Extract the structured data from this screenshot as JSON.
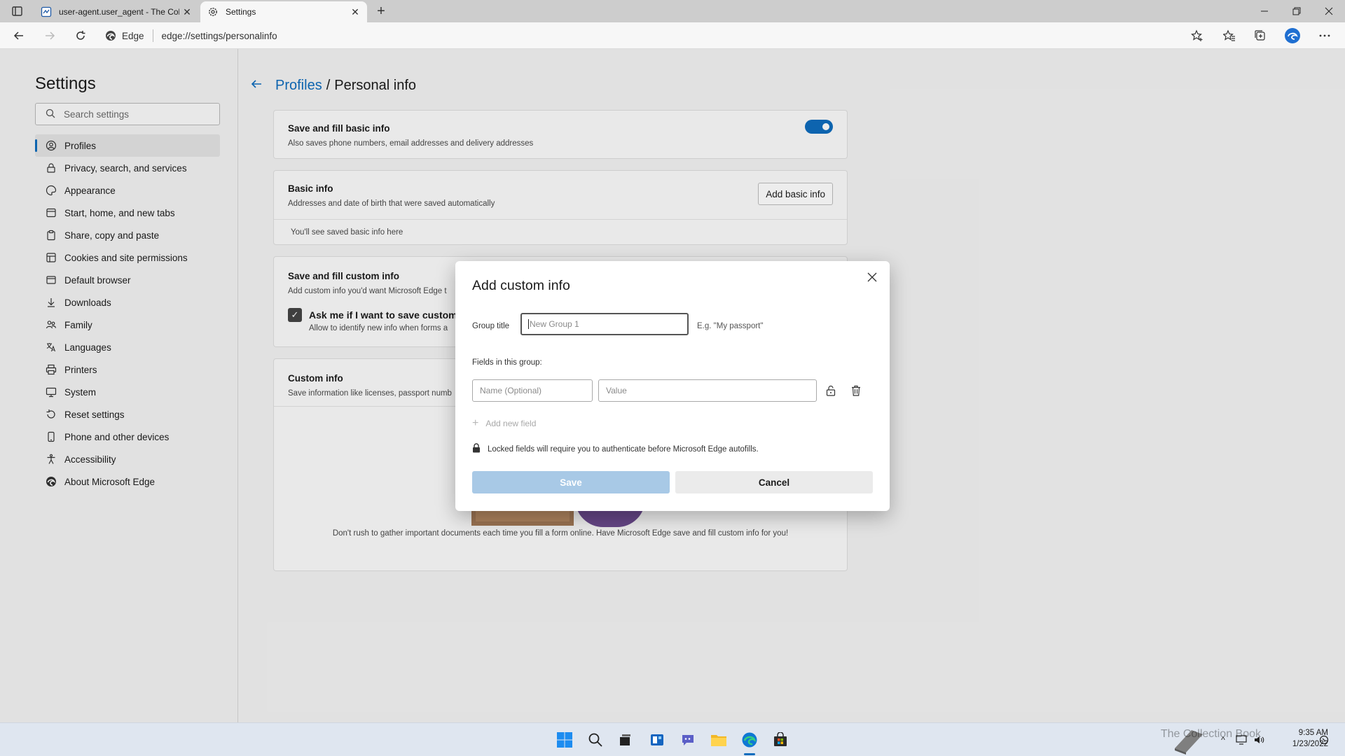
{
  "browser": {
    "tabs": [
      {
        "title": "user-agent.user_agent - The Coll"
      },
      {
        "title": "Settings"
      }
    ],
    "address": {
      "chip": "Edge",
      "url": "edge://settings/personalinfo"
    }
  },
  "sidebar": {
    "title": "Settings",
    "search_placeholder": "Search settings",
    "items": [
      {
        "label": "Profiles"
      },
      {
        "label": "Privacy, search, and services"
      },
      {
        "label": "Appearance"
      },
      {
        "label": "Start, home, and new tabs"
      },
      {
        "label": "Share, copy and paste"
      },
      {
        "label": "Cookies and site permissions"
      },
      {
        "label": "Default browser"
      },
      {
        "label": "Downloads"
      },
      {
        "label": "Family"
      },
      {
        "label": "Languages"
      },
      {
        "label": "Printers"
      },
      {
        "label": "System"
      },
      {
        "label": "Reset settings"
      },
      {
        "label": "Phone and other devices"
      },
      {
        "label": "Accessibility"
      },
      {
        "label": "About Microsoft Edge"
      }
    ]
  },
  "main": {
    "breadcrumb": {
      "parent": "Profiles",
      "separator": "/",
      "current": "Personal info"
    },
    "basic_fill": {
      "title": "Save and fill basic info",
      "subtitle": "Also saves phone numbers, email addresses and delivery addresses"
    },
    "basic_info": {
      "title": "Basic info",
      "subtitle": "Addresses and date of birth that were saved automatically",
      "button": "Add basic info",
      "empty": "You'll see saved basic info here"
    },
    "custom_fill": {
      "title": "Save and fill custom info",
      "subtitle": "Add custom info you'd want Microsoft Edge t",
      "checkbox_label": "Ask me if I want to save custom i",
      "checkbox_sub": "Allow to identify new info when forms a"
    },
    "custom_info": {
      "title": "Custom info",
      "subtitle": "Save information like licenses, passport numb",
      "footer": "Don't rush to gather important documents each time you fill a form online. Have Microsoft Edge save and fill custom info for you!"
    }
  },
  "dialog": {
    "title": "Add custom info",
    "group_title_label": "Group title",
    "group_title_placeholder": "New Group 1",
    "group_title_hint": "E.g. \"My passport\"",
    "fields_label": "Fields in this group:",
    "name_placeholder": "Name (Optional)",
    "value_placeholder": "Value",
    "add_field": "Add new field",
    "lock_note": "Locked fields will require you to authenticate before Microsoft Edge autofills.",
    "save": "Save",
    "cancel": "Cancel"
  },
  "taskbar": {
    "time": "9:35 AM",
    "date": "1/23/2022",
    "watermark": "The Collection Book"
  },
  "colors": {
    "accent": "#0f6cbd",
    "save_disabled": "#a8c9e6"
  }
}
